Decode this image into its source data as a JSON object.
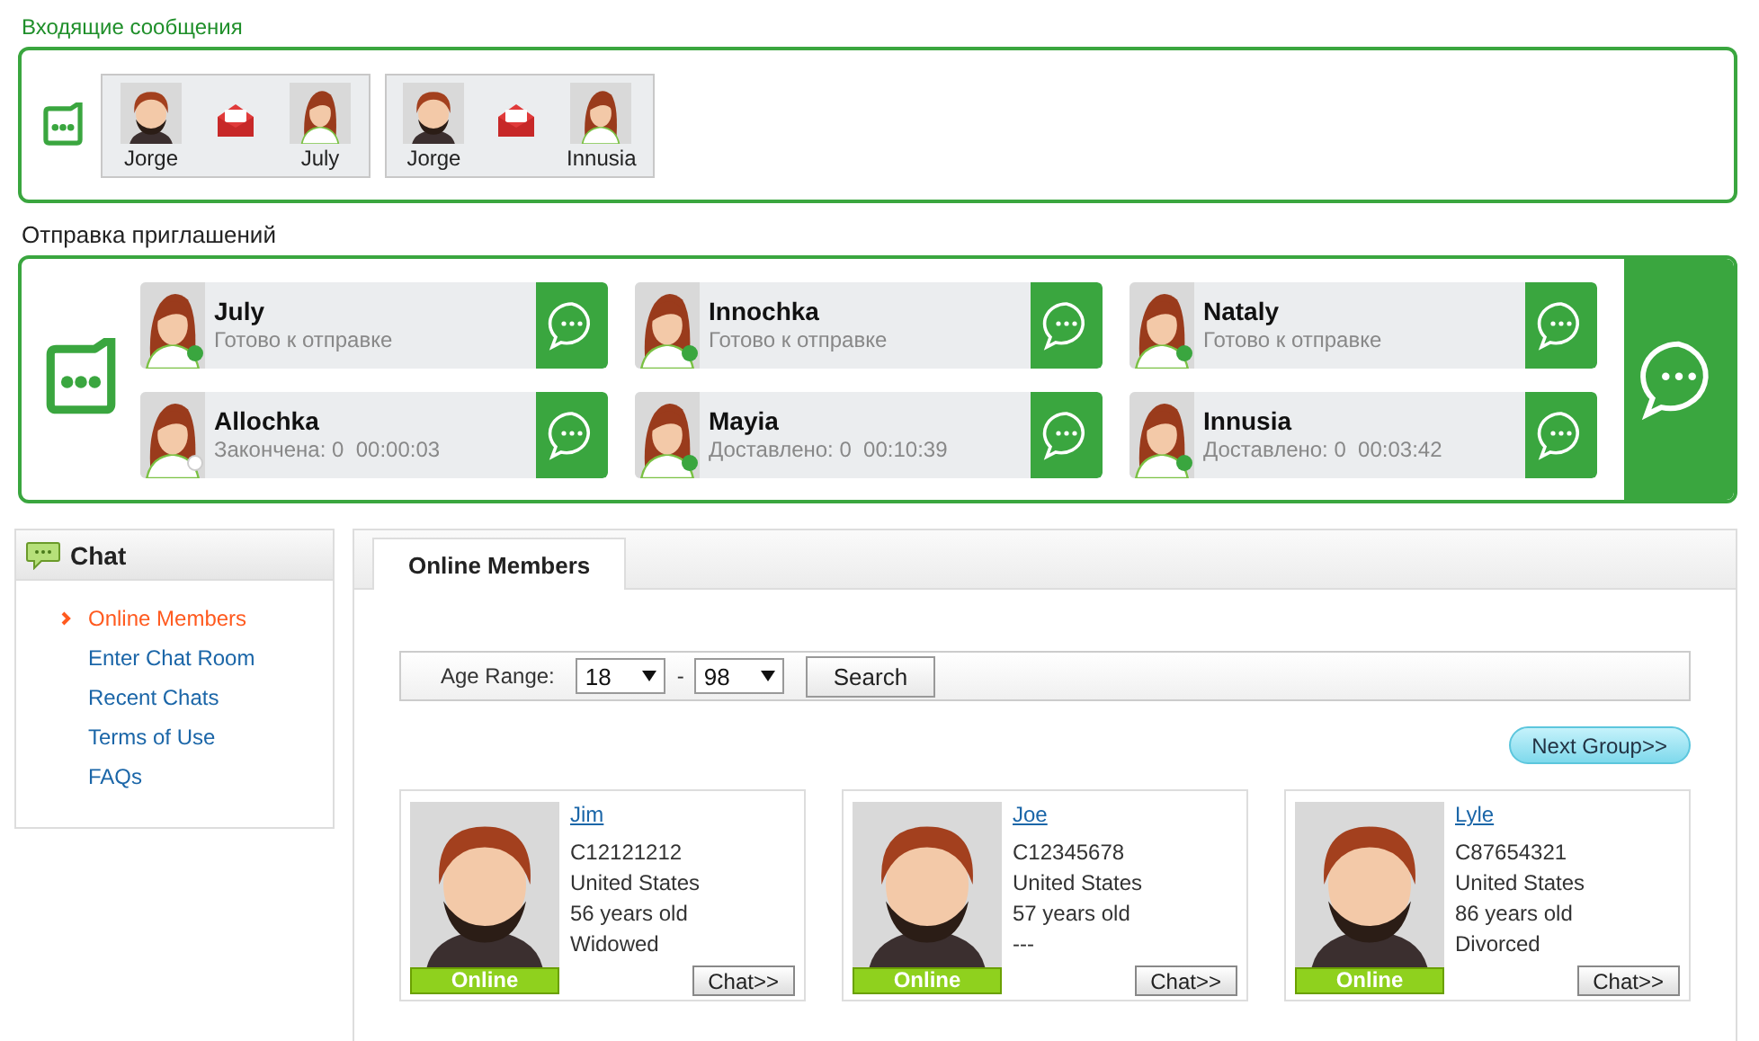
{
  "inbox": {
    "title": "Входящие сообщения",
    "messages": [
      {
        "from": "Jorge",
        "to": "July"
      },
      {
        "from": "Jorge",
        "to": "Innusia"
      }
    ]
  },
  "invitations": {
    "title": "Отправка приглашений",
    "items": [
      {
        "name": "July",
        "status": "Готово к отправке",
        "online": true
      },
      {
        "name": "Innochka",
        "status": "Готово к отправке",
        "online": true
      },
      {
        "name": "Nataly",
        "status": "Готово к отправке",
        "online": true
      },
      {
        "name": "Allochka",
        "status": "Закончена: 0  00:00:03",
        "online": false
      },
      {
        "name": "Mayia",
        "status": "Доставлено: 0  00:10:39",
        "online": true
      },
      {
        "name": "Innusia",
        "status": "Доставлено: 0  00:03:42",
        "online": true
      }
    ]
  },
  "sidebar": {
    "title": "Chat",
    "items": [
      {
        "label": "Online Members",
        "selected": true
      },
      {
        "label": "Enter Chat Room",
        "selected": false
      },
      {
        "label": "Recent Chats",
        "selected": false
      },
      {
        "label": "Terms of Use",
        "selected": false
      },
      {
        "label": "FAQs",
        "selected": false
      }
    ]
  },
  "tabs": [
    {
      "label": "Online Members",
      "selected": true
    }
  ],
  "filter": {
    "label": "Age Range:",
    "min": "18",
    "separator": "-",
    "max": "98",
    "button": "Search"
  },
  "next_button": "Next Group>>",
  "members": [
    {
      "name": "Jim",
      "id": "C12121212",
      "country": "United States",
      "age": "56 years old",
      "status": "Widowed",
      "presence": "Online",
      "button": "Chat>>"
    },
    {
      "name": "Joe",
      "id": "C12345678",
      "country": "United States",
      "age": "57 years old",
      "status": "---",
      "presence": "Online",
      "button": "Chat>>"
    },
    {
      "name": "Lyle",
      "id": "C87654321",
      "country": "United States",
      "age": "86 years old",
      "status": "Divorced",
      "presence": "Online",
      "button": "Chat>>"
    }
  ]
}
